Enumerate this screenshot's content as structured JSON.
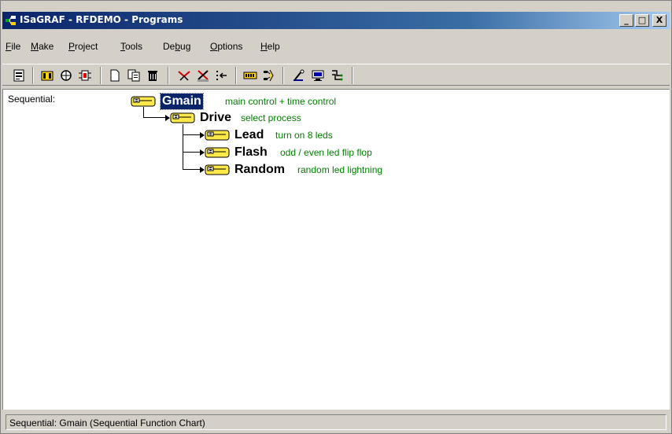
{
  "window": {
    "title": "ISaGRAF - RFDEMO - Programs",
    "icon": "isagraf-app-icon",
    "controls": {
      "minimize": "_",
      "maximize": "□",
      "close": "X"
    }
  },
  "menu": {
    "items": [
      {
        "label": "File",
        "access_key": "F"
      },
      {
        "label": "Make",
        "access_key": "M"
      },
      {
        "label": "Project",
        "access_key": "P"
      },
      {
        "label": "Tools",
        "access_key": "T"
      },
      {
        "label": "Debug",
        "access_key": "b"
      },
      {
        "label": "Options",
        "access_key": "O"
      },
      {
        "label": "Help",
        "access_key": "H"
      }
    ]
  },
  "toolbar": {
    "buttons": [
      "properties-icon",
      "dictionary-icon",
      "link-icon",
      "io-connection-icon",
      "new-program-icon",
      "copy-icon",
      "delete-icon",
      "compile-icon",
      "verify-icon",
      "step-icon",
      "io-board-icon",
      "simulate-icon",
      "debug-icon",
      "target-icon",
      "connect-icon"
    ]
  },
  "programs": {
    "section": "Sequential:",
    "tree": [
      {
        "name": "Gmain",
        "description": "main control + time control",
        "level": 0,
        "selected": true
      },
      {
        "name": "Drive",
        "description": "select process",
        "level": 1,
        "selected": false
      },
      {
        "name": "Lead",
        "description": "turn on 8 leds",
        "level": 2,
        "selected": false
      },
      {
        "name": "Flash",
        "description": "odd / even led flip flop",
        "level": 2,
        "selected": false
      },
      {
        "name": "Random",
        "description": "random led lightning",
        "level": 2,
        "selected": false
      }
    ]
  },
  "status": {
    "text": "Sequential:  Gmain  (Sequential Function Chart)"
  },
  "colors": {
    "title_gradient_start": "#0a246a",
    "title_gradient_end": "#a6caf0",
    "description_text": "#008000",
    "selection": "#0a246a",
    "program_icon_fill": "#ffe84a"
  }
}
